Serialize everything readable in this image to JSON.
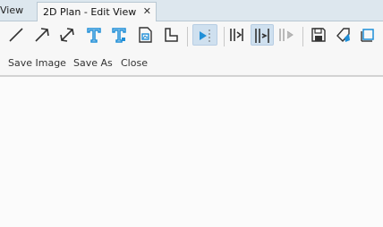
{
  "tabs": {
    "previous_label": "View",
    "active_label": "2D Plan - Edit View",
    "close_glyph": "✕"
  },
  "toolbar": {
    "icons": [
      "line-icon",
      "arrow-icon",
      "double-arrow-icon",
      "text-icon",
      "text-alt-icon",
      "image-text-icon",
      "angle-dimension-icon",
      "pointer-select-icon",
      "align-left-icon",
      "align-center-icon",
      "align-right-icon",
      "save-plan-icon",
      "erase-tag-icon",
      "crop-frame-icon"
    ],
    "accent_color": "#1f8fd8",
    "selected_bg": "#cfe0ef"
  },
  "commands": {
    "save_image": "Save Image",
    "save_as": "Save As",
    "close": "Close"
  }
}
